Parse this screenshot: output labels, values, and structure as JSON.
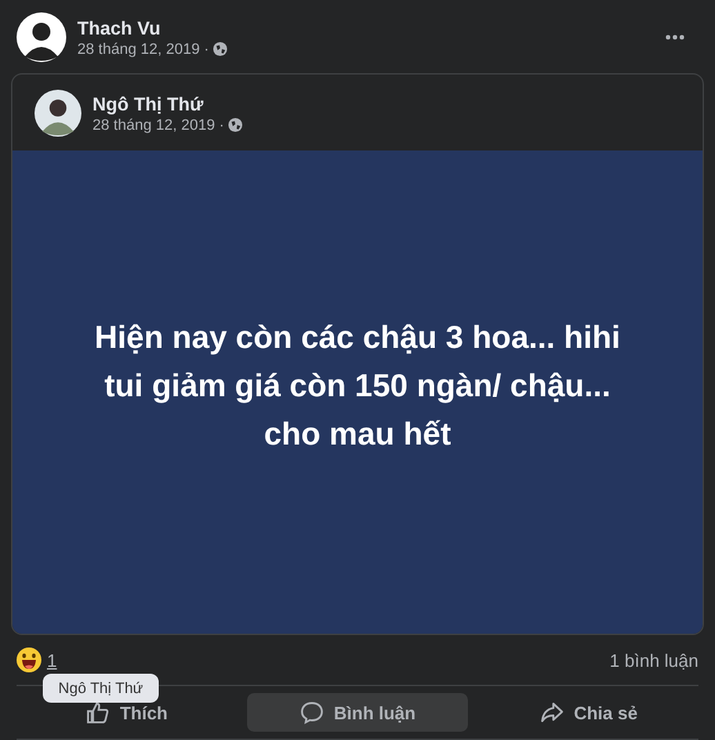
{
  "post": {
    "author": "Thach Vu",
    "time": "28 tháng 12, 2019 ·"
  },
  "shared": {
    "author": "Ngô Thị Thứ",
    "time": "28 tháng 12, 2019 ·",
    "lines": [
      "Hiện nay còn các chậu 3 hoa... hihi",
      "tui giảm giá còn 150 ngàn/ chậu...",
      "cho mau hết"
    ]
  },
  "reactions": {
    "count": "1",
    "comments": "1 bình luận"
  },
  "actions": [
    {
      "kind": "like",
      "label": "Thích",
      "hovered": false
    },
    {
      "kind": "comment",
      "label": "Bình luận",
      "hovered": true
    },
    {
      "kind": "share",
      "label": "Chia sẻ",
      "hovered": false
    }
  ],
  "tooltip": {
    "text": "Ngô Thị Thứ"
  }
}
